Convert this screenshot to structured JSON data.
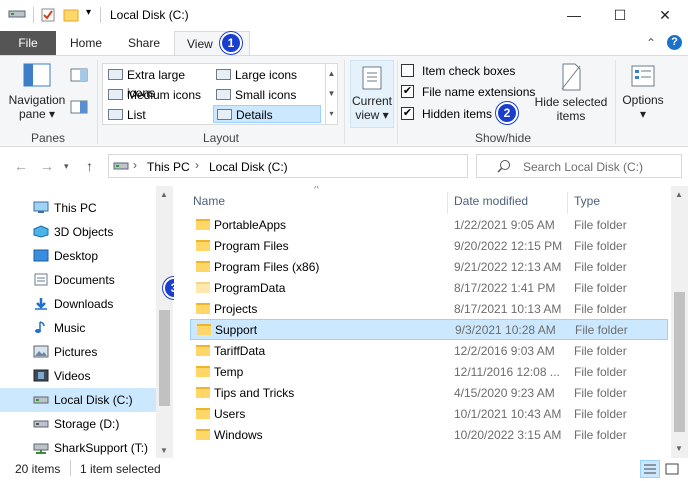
{
  "window": {
    "title": "Local Disk (C:)",
    "minimize": "—",
    "maximize": "☐",
    "close": "✕"
  },
  "tabs": [
    {
      "label": "File"
    },
    {
      "label": "Home"
    },
    {
      "label": "Share"
    },
    {
      "label": "View"
    }
  ],
  "badges": [
    "1",
    "2",
    "3"
  ],
  "ribbon": {
    "panes": {
      "nav_label": "Navigation\npane",
      "nav_line1": "Navigation",
      "nav_line2": "pane ▾",
      "group": "Panes"
    },
    "layout": {
      "group": "Layout",
      "items": [
        "Extra large icons",
        "Large icons",
        "Medium icons",
        "Small icons",
        "List",
        "Details"
      ],
      "selected": "Details"
    },
    "current_view": {
      "line1": "Current",
      "line2": "view ▾"
    },
    "showhide": {
      "group": "Show/hide",
      "item_check_boxes": {
        "label": "Item check boxes",
        "checked": false
      },
      "file_name_extensions": {
        "label": "File name extensions",
        "checked": true
      },
      "hidden_items": {
        "label": "Hidden items",
        "checked": true
      },
      "hide_selected_line1": "Hide selected",
      "hide_selected_line2": "items"
    },
    "options": {
      "line1": "Options",
      "line2": "▾"
    }
  },
  "address": {
    "crumbs": [
      "This PC",
      "Local Disk (C:)"
    ],
    "refresh": "↻",
    "search_placeholder": "Search Local Disk (C:)"
  },
  "navpane": {
    "items": [
      "This PC",
      "3D Objects",
      "Desktop",
      "Documents",
      "Downloads",
      "Music",
      "Pictures",
      "Videos",
      "Local Disk (C:)",
      "Storage (D:)",
      "SharkSupport (T:)"
    ],
    "selected": "Local Disk (C:)"
  },
  "filelist": {
    "columns": [
      "Name",
      "Date modified",
      "Type"
    ],
    "rows": [
      {
        "name": "PortableApps",
        "date": "1/22/2021 9:05 AM",
        "type": "File folder"
      },
      {
        "name": "Program Files",
        "date": "9/20/2022 12:15 PM",
        "type": "File folder"
      },
      {
        "name": "Program Files (x86)",
        "date": "9/21/2022 12:13 AM",
        "type": "File folder"
      },
      {
        "name": "ProgramData",
        "date": "8/17/2022 1:41 PM",
        "type": "File folder"
      },
      {
        "name": "Projects",
        "date": "8/17/2021 10:13 AM",
        "type": "File folder"
      },
      {
        "name": "Support",
        "date": "9/3/2021 10:28 AM",
        "type": "File folder"
      },
      {
        "name": "TariffData",
        "date": "12/2/2016 9:03 AM",
        "type": "File folder"
      },
      {
        "name": "Temp",
        "date": "12/11/2016 12:08 ...",
        "type": "File folder"
      },
      {
        "name": "Tips and Tricks",
        "date": "4/15/2020 9:23 AM",
        "type": "File folder"
      },
      {
        "name": "Users",
        "date": "10/1/2021 10:43 AM",
        "type": "File folder"
      },
      {
        "name": "Windows",
        "date": "10/20/2022 3:15 AM",
        "type": "File folder"
      }
    ],
    "selected": "Support"
  },
  "status": {
    "count": "20 items",
    "selected": "1 item selected"
  },
  "colors": {
    "accent": "#1a3fd0",
    "selection": "#cce8ff",
    "file_tab": "#555555"
  }
}
